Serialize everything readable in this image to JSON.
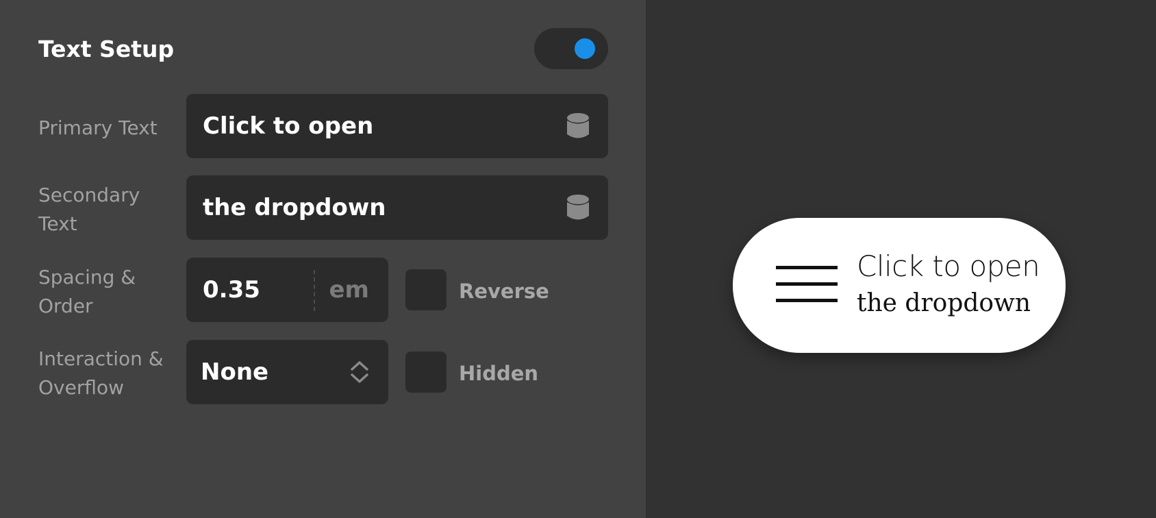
{
  "panel": {
    "title": "Text Setup",
    "toggle_on": true,
    "accent_color": "#1a8fe8"
  },
  "fields": {
    "primary_label": "Primary Text",
    "primary_value": "Click to open",
    "secondary_label_1": "Secondary",
    "secondary_label_2": "Text",
    "secondary_value": "the dropdown",
    "spacing_label_1": "Spacing &",
    "spacing_label_2": "Order",
    "spacing_value": "0.35",
    "spacing_unit": "em",
    "reverse_label": "Reverse",
    "reverse_checked": false,
    "interaction_label_1": "Interaction &",
    "interaction_label_2": "Overflow",
    "interaction_value": "None",
    "hidden_label": "Hidden",
    "hidden_checked": false
  },
  "preview": {
    "icon": "hamburger-icon",
    "primary": "Click to open",
    "secondary": "the dropdown"
  }
}
